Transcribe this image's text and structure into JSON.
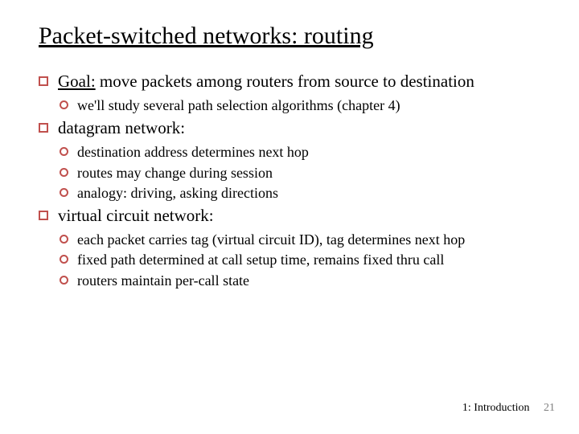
{
  "title": "Packet-switched networks: routing",
  "items": [
    {
      "lead": "Goal:",
      "rest": " move packets among routers from source to destination",
      "sub": [
        "we'll study several path selection algorithms (chapter 4)"
      ]
    },
    {
      "text": "datagram network:",
      "sub": [
        "destination address determines next hop",
        "routes may change during session",
        "analogy: driving, asking directions"
      ]
    },
    {
      "text": "virtual circuit network:",
      "sub": [
        "each packet carries tag  (virtual circuit ID), tag determines next hop",
        "fixed path determined at call setup time, remains fixed thru call",
        "routers maintain per-call state"
      ]
    }
  ],
  "footer": {
    "section": "1: Introduction",
    "page": "21"
  }
}
